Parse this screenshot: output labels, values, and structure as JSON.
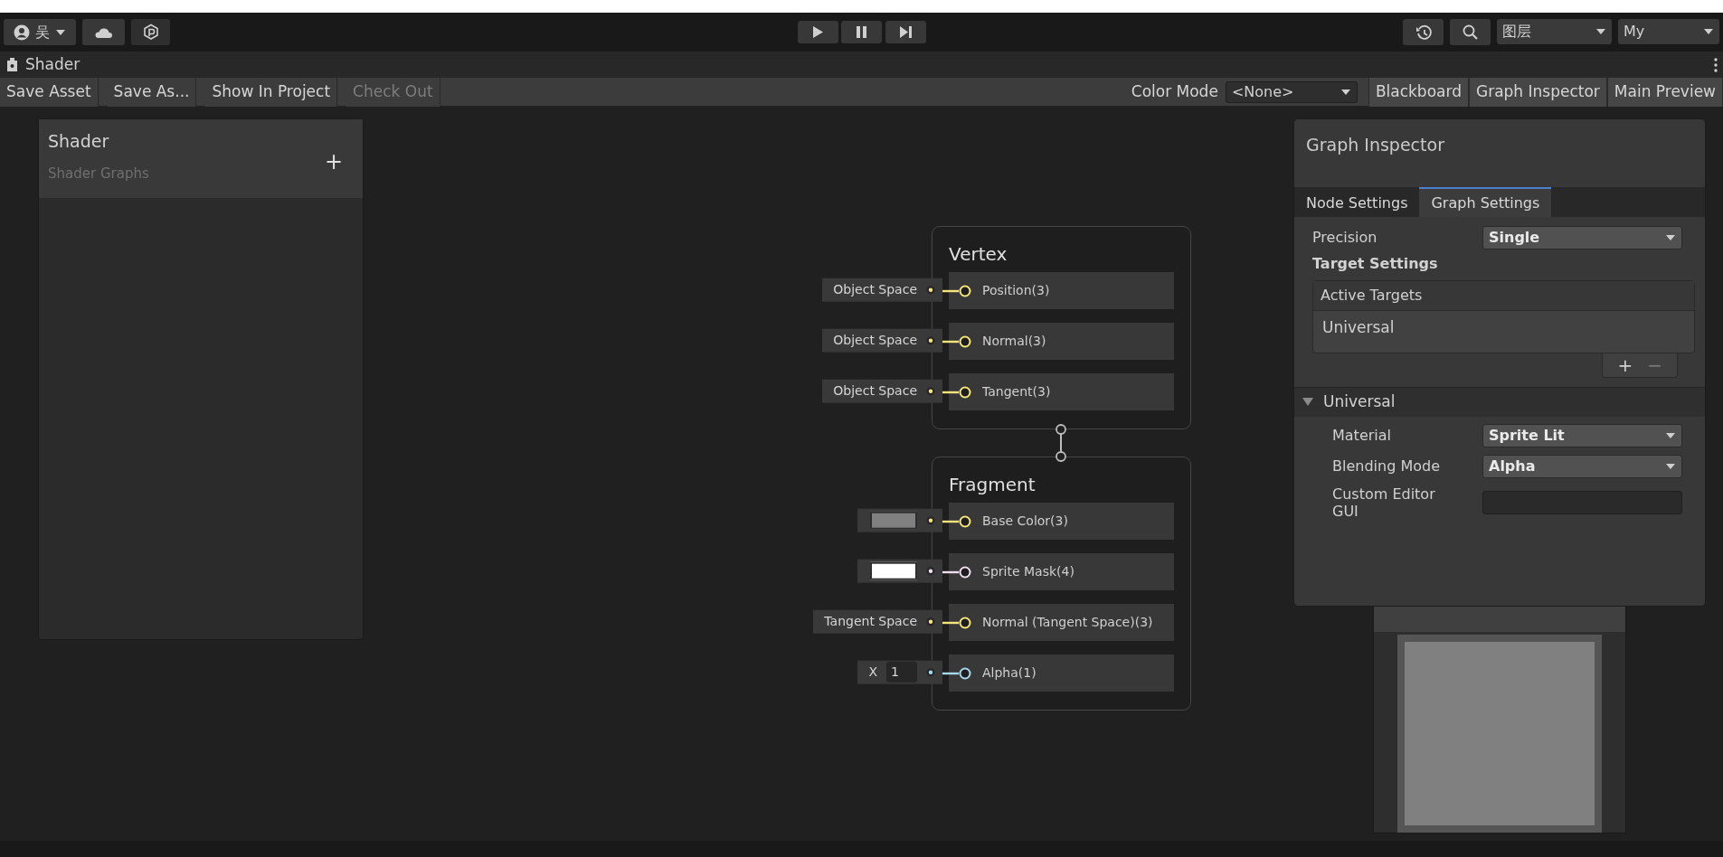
{
  "toolbar": {
    "account": "吴",
    "layers": "图层",
    "layout": "My"
  },
  "window": {
    "title": "Shader"
  },
  "graph_toolbar": {
    "left_buttons": [
      {
        "label": "Save Asset",
        "disabled": false
      },
      {
        "label": "Save As...",
        "disabled": false
      },
      {
        "label": "Show In Project",
        "disabled": false
      },
      {
        "label": "Check Out",
        "disabled": true
      }
    ],
    "color_mode": {
      "label": "Color Mode",
      "value": "<None>"
    },
    "right_buttons": [
      {
        "label": "Blackboard"
      },
      {
        "label": "Graph Inspector"
      },
      {
        "label": "Main Preview"
      }
    ]
  },
  "blackboard": {
    "title": "Shader",
    "subtitle": "Shader Graphs",
    "add": "+"
  },
  "nodes": [
    {
      "title": "Vertex",
      "ports": [
        {
          "label": "Position(3)",
          "color": "#f5e47a",
          "input": {
            "kind": "dropdown",
            "text": "Object Space"
          }
        },
        {
          "label": "Normal(3)",
          "color": "#f5e47a",
          "input": {
            "kind": "dropdown",
            "text": "Object Space"
          }
        },
        {
          "label": "Tangent(3)",
          "color": "#f5e47a",
          "input": {
            "kind": "dropdown",
            "text": "Object Space"
          }
        }
      ]
    },
    {
      "title": "Fragment",
      "ports": [
        {
          "label": "Base Color(3)",
          "color": "#f5e47a",
          "input": {
            "kind": "swatch",
            "color": "#808080"
          }
        },
        {
          "label": "Sprite Mask(4)",
          "color": "#f2dcef",
          "input": {
            "kind": "swatch",
            "color": "#ffffff"
          }
        },
        {
          "label": "Normal (Tangent Space)(3)",
          "color": "#f5e47a",
          "input": {
            "kind": "dropdown",
            "text": "Tangent Space"
          }
        },
        {
          "label": "Alpha(1)",
          "color": "#a6d9ee",
          "input": {
            "kind": "float",
            "axis": "X",
            "value": "1"
          }
        }
      ]
    }
  ],
  "inspector": {
    "title": "Graph Inspector",
    "tabs": [
      {
        "label": "Node Settings",
        "selected": false
      },
      {
        "label": "Graph Settings",
        "selected": true
      }
    ],
    "precision": {
      "label": "Precision",
      "value": "Single"
    },
    "target_settings": "Target Settings",
    "active_targets": {
      "header": "Active Targets",
      "items": [
        "Universal"
      ],
      "add": "+",
      "remove": "−"
    },
    "section": {
      "title": "Universal",
      "expanded": true,
      "fields": [
        {
          "kind": "dropdown",
          "label": "Material",
          "value": "Sprite Lit"
        },
        {
          "kind": "dropdown",
          "label": "Blending Mode",
          "value": "Alpha"
        },
        {
          "kind": "text",
          "label": "Custom Editor GUI"
        }
      ]
    }
  }
}
